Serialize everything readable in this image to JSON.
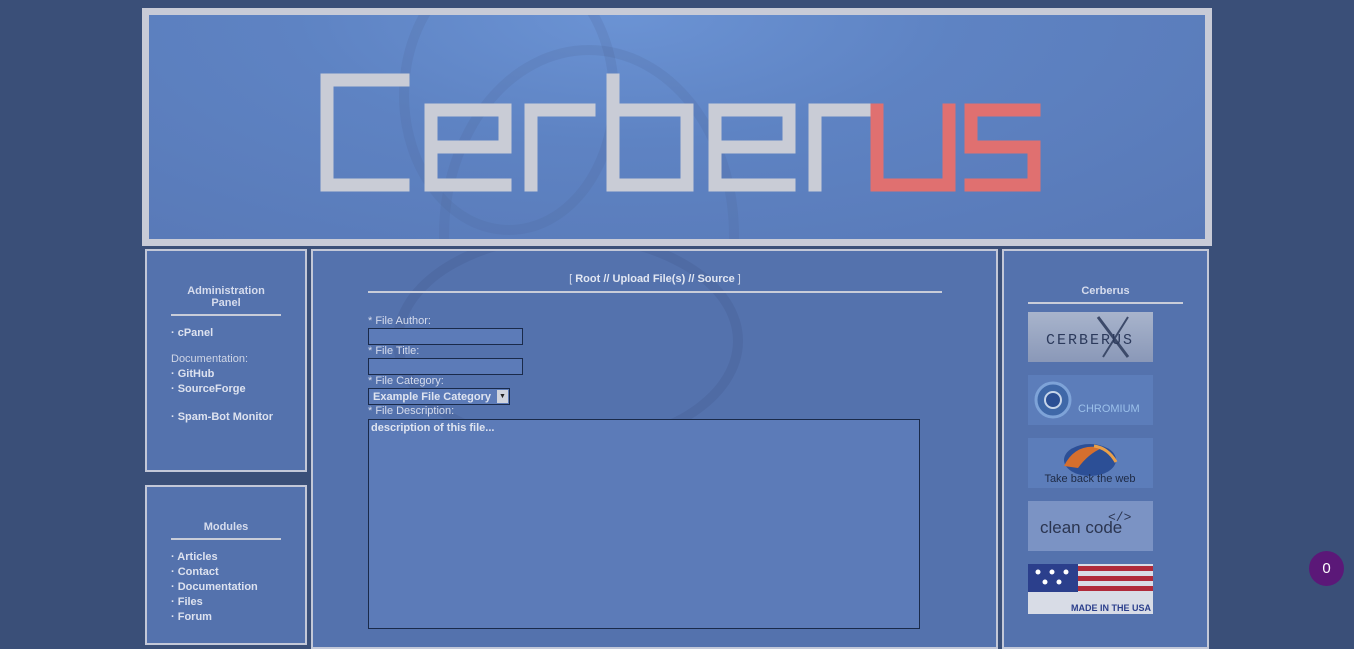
{
  "banner": {
    "logo_text": "Cerberus"
  },
  "admin_panel": {
    "title": "Administration Panel",
    "cpanel": "· cPanel",
    "documentation_label": "Documentation:",
    "github": "· GitHub",
    "sourceforge": "· SourceForge",
    "spambot": "· Spam-Bot Monitor"
  },
  "modules": {
    "title": "Modules",
    "items": [
      "· Articles",
      "· Contact",
      "· Documentation",
      "· Files",
      "· Forum"
    ]
  },
  "main": {
    "crumb_open": "[ ",
    "crumb_text": "Root // Upload File(s) // Source",
    "crumb_close": " ]",
    "author_label": "* File Author:",
    "title_label": "* File Title:",
    "category_label": "* File Category:",
    "category_value": "Example File Category",
    "description_label": "* File Description:",
    "description_value": "description of this file..."
  },
  "sidebar_right": {
    "title": "Cerberus",
    "badges": [
      {
        "name": "cerberus",
        "text": "CERBERUS"
      },
      {
        "name": "chromium",
        "text": "CHROMIUM"
      },
      {
        "name": "firefox",
        "text": "Take back the web"
      },
      {
        "name": "clean-code",
        "text": "clean code"
      },
      {
        "name": "made-in-usa",
        "text": "MADE IN THE USA"
      }
    ]
  },
  "chat": {
    "count": "0"
  },
  "colors": {
    "background": "#3a4f78",
    "panel": "#5472ad",
    "accent_red": "#e06060",
    "chat": "#5b1878"
  }
}
